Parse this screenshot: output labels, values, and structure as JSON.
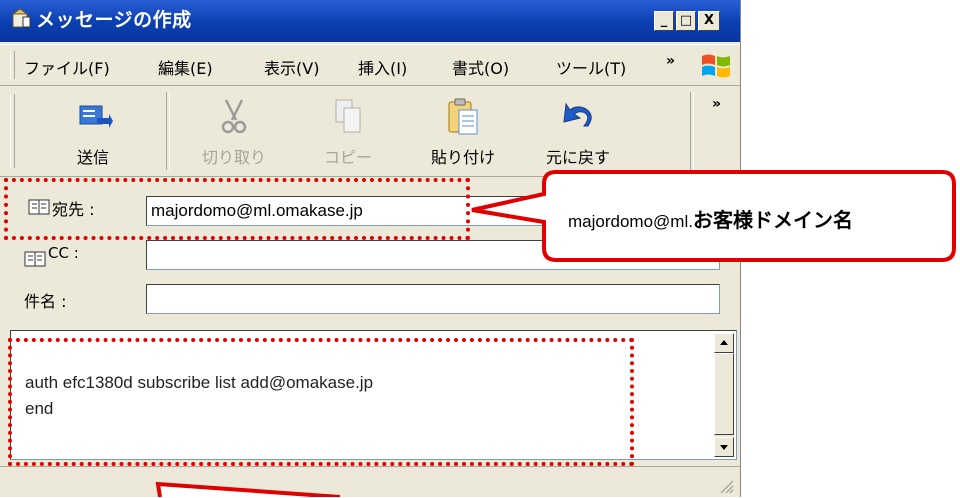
{
  "window": {
    "title": "メッセージの作成",
    "controls": {
      "minimize": "_",
      "maximize": "□",
      "close": "X"
    }
  },
  "menu": {
    "items": [
      "ファイル(F)",
      "編集(E)",
      "表示(V)",
      "挿入(I)",
      "書式(O)",
      "ツール(T)"
    ],
    "more": "»"
  },
  "toolbar": {
    "buttons": [
      {
        "label": "送信",
        "icon": "send-icon",
        "enabled": true
      },
      {
        "label": "切り取り",
        "icon": "scissors-icon",
        "enabled": false
      },
      {
        "label": "コピー",
        "icon": "copy-icon",
        "enabled": false
      },
      {
        "label": "貼り付け",
        "icon": "paste-icon",
        "enabled": true
      },
      {
        "label": "元に戻す",
        "icon": "undo-icon",
        "enabled": true
      }
    ],
    "more": "»"
  },
  "headers": {
    "to": {
      "label": "宛先 :",
      "value": "majordomo@ml.omakase.jp"
    },
    "cc": {
      "label": "CC :",
      "value": ""
    },
    "subject": {
      "label": "件名 :",
      "value": ""
    }
  },
  "body": {
    "lines": [
      "auth efc1380d subscribe list add@omakase.jp",
      "end"
    ]
  },
  "annotations": {
    "to_callout_prefix": "majordomo@ml.",
    "to_callout_emphasis": "お客様ドメイン名",
    "body_callout_text": "",
    "highlight_color": "#e00000"
  }
}
